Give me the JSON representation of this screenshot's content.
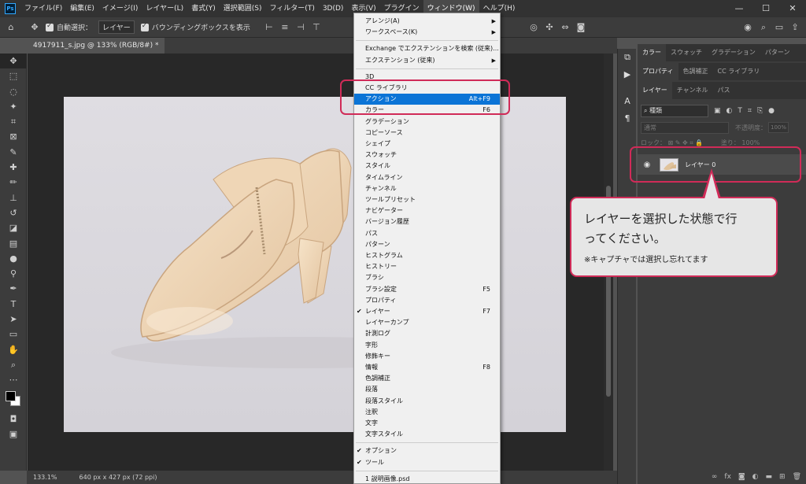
{
  "app": {
    "logo": "Ps"
  },
  "menubar": {
    "items": [
      "ファイル(F)",
      "編集(E)",
      "イメージ(I)",
      "レイヤー(L)",
      "書式(Y)",
      "選択範囲(S)",
      "フィルター(T)",
      "3D(D)",
      "表示(V)",
      "プラグイン",
      "ウィンドウ(W)",
      "ヘルプ(H)"
    ],
    "active_index": 10
  },
  "window_controls": {
    "minimize": "—",
    "maximize": "☐",
    "close": "✕"
  },
  "options_bar": {
    "auto_select_label": "自動選択：",
    "auto_select_target": "レイヤー",
    "bounding_box_label": "バウンディングボックスを表示"
  },
  "document": {
    "tab_title": "4917911_s.jpg @ 133% (RGB/8#) *",
    "zoom": "133.1%",
    "dimensions": "640 px x 427 px (72 ppi)"
  },
  "panels": {
    "row1_tabs": [
      "カラー",
      "スウォッチ",
      "グラデーション",
      "パターン"
    ],
    "row2_tabs": [
      "プロパティ",
      "色調補正",
      "CC ライブラリ"
    ],
    "row3_tabs": [
      "レイヤー",
      "チャンネル",
      "パス"
    ],
    "filter_kind": "種類",
    "blend_mode": "通常",
    "opacity_label": "不透明度：",
    "opacity_value": "100%",
    "lock_label": "ロック：",
    "fill_label": "塗り：",
    "fill_value": "100%",
    "layer_name": "レイヤー 0"
  },
  "window_menu": {
    "items": [
      {
        "label": "アレンジ(A)",
        "submenu": true
      },
      {
        "label": "ワークスペース(K)",
        "submenu": true
      },
      {
        "label": "Exchange でエクステンションを検索 (従来)..."
      },
      {
        "label": "エクステンション (従来)",
        "submenu": true
      },
      {
        "label": "3D"
      },
      {
        "label": "CC ライブラリ"
      },
      {
        "label": "アクション",
        "shortcut": "Alt+F9",
        "highlighted": true
      },
      {
        "label": "カラー",
        "shortcut": "F6"
      },
      {
        "label": "グラデーション"
      },
      {
        "label": "コピーソース"
      },
      {
        "label": "シェイプ"
      },
      {
        "label": "スウォッチ"
      },
      {
        "label": "スタイル"
      },
      {
        "label": "タイムライン"
      },
      {
        "label": "チャンネル"
      },
      {
        "label": "ツールプリセット"
      },
      {
        "label": "ナビゲーター"
      },
      {
        "label": "バージョン履歴"
      },
      {
        "label": "パス"
      },
      {
        "label": "パターン"
      },
      {
        "label": "ヒストグラム"
      },
      {
        "label": "ヒストリー"
      },
      {
        "label": "ブラシ"
      },
      {
        "label": "ブラシ設定",
        "shortcut": "F5"
      },
      {
        "label": "プロパティ"
      },
      {
        "label": "レイヤー",
        "shortcut": "F7",
        "checked": true
      },
      {
        "label": "レイヤーカンプ"
      },
      {
        "label": "計測ログ"
      },
      {
        "label": "字形"
      },
      {
        "label": "修飾キー"
      },
      {
        "label": "情報",
        "shortcut": "F8"
      },
      {
        "label": "色調補正"
      },
      {
        "label": "段落"
      },
      {
        "label": "段落スタイル"
      },
      {
        "label": "注釈"
      },
      {
        "label": "文字"
      },
      {
        "label": "文字スタイル"
      },
      {
        "label": "オプション",
        "checked": true
      },
      {
        "label": "ツール",
        "checked": true
      },
      {
        "label": "1 説明画像.psd"
      }
    ]
  },
  "callout": {
    "line1": "レイヤーを選択した状態で行",
    "line2": "ってください。",
    "note": "※キャプチャでは選択し忘れてます"
  },
  "colors": {
    "highlight": "#d02b58",
    "menu_selection": "#0b74d6"
  }
}
